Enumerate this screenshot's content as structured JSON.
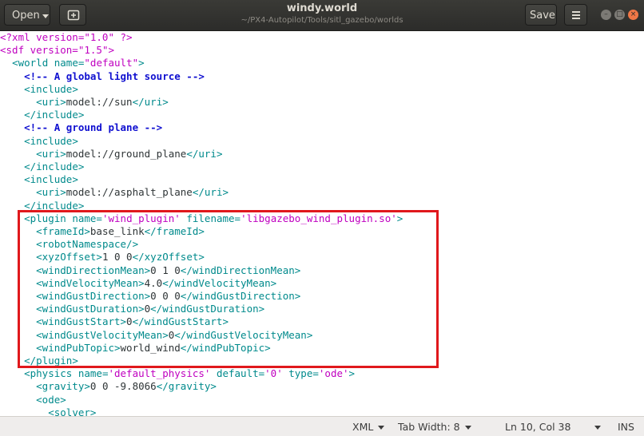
{
  "header": {
    "open_label": "Open",
    "title": "windy.world",
    "subtitle": "~/PX4-Autopilot/Tools/sitl_gazebo/worlds",
    "save_label": "Save"
  },
  "editor": {
    "lines": [
      {
        "indent": "",
        "segments": [
          {
            "t": "<?xml version=\"1.0\" ?>",
            "c": "pi"
          }
        ]
      },
      {
        "indent": "",
        "segments": [
          {
            "t": "<sdf version=",
            "c": "pi"
          },
          {
            "t": "\"1.5\"",
            "c": "pi"
          },
          {
            "t": ">",
            "c": "pi"
          }
        ]
      },
      {
        "indent": "  ",
        "segments": [
          {
            "t": "<world ",
            "c": "tag"
          },
          {
            "t": "name=",
            "c": "attr"
          },
          {
            "t": "\"default\"",
            "c": "val"
          },
          {
            "t": ">",
            "c": "tag"
          }
        ]
      },
      {
        "indent": "    ",
        "segments": [
          {
            "t": "<!-- A global light source -->",
            "c": "comment"
          }
        ]
      },
      {
        "indent": "    ",
        "segments": [
          {
            "t": "<include>",
            "c": "tag"
          }
        ]
      },
      {
        "indent": "      ",
        "segments": [
          {
            "t": "<uri>",
            "c": "tag"
          },
          {
            "t": "model://sun",
            "c": "text"
          },
          {
            "t": "</uri>",
            "c": "tag"
          }
        ]
      },
      {
        "indent": "    ",
        "segments": [
          {
            "t": "</include>",
            "c": "tag"
          }
        ]
      },
      {
        "indent": "    ",
        "segments": [
          {
            "t": "<!-- A ground plane -->",
            "c": "comment"
          }
        ]
      },
      {
        "indent": "    ",
        "segments": [
          {
            "t": "<include>",
            "c": "tag"
          }
        ]
      },
      {
        "indent": "      ",
        "segments": [
          {
            "t": "<uri>",
            "c": "tag"
          },
          {
            "t": "model://ground_plane",
            "c": "text"
          },
          {
            "t": "</uri>",
            "c": "tag"
          }
        ]
      },
      {
        "indent": "    ",
        "segments": [
          {
            "t": "</include>",
            "c": "tag"
          }
        ]
      },
      {
        "indent": "    ",
        "segments": [
          {
            "t": "<include>",
            "c": "tag"
          }
        ]
      },
      {
        "indent": "      ",
        "segments": [
          {
            "t": "<uri>",
            "c": "tag"
          },
          {
            "t": "model://asphalt_plane",
            "c": "text"
          },
          {
            "t": "</uri>",
            "c": "tag"
          }
        ]
      },
      {
        "indent": "    ",
        "segments": [
          {
            "t": "</include>",
            "c": "tag"
          }
        ]
      },
      {
        "indent": "    ",
        "segments": [
          {
            "t": "<plugin ",
            "c": "tag"
          },
          {
            "t": "name=",
            "c": "attr"
          },
          {
            "t": "'wind_plugin'",
            "c": "val"
          },
          {
            "t": " filename=",
            "c": "attr"
          },
          {
            "t": "'libgazebo_wind_plugin.so'",
            "c": "val"
          },
          {
            "t": ">",
            "c": "tag"
          }
        ]
      },
      {
        "indent": "      ",
        "segments": [
          {
            "t": "<frameId>",
            "c": "tag"
          },
          {
            "t": "base_link",
            "c": "text"
          },
          {
            "t": "</frameId>",
            "c": "tag"
          }
        ]
      },
      {
        "indent": "      ",
        "segments": [
          {
            "t": "<robotNamespace/>",
            "c": "tag"
          }
        ]
      },
      {
        "indent": "      ",
        "segments": [
          {
            "t": "<xyzOffset>",
            "c": "tag"
          },
          {
            "t": "1 0 0",
            "c": "text"
          },
          {
            "t": "</xyzOffset>",
            "c": "tag"
          }
        ]
      },
      {
        "indent": "      ",
        "segments": [
          {
            "t": "<windDirectionMean>",
            "c": "tag"
          },
          {
            "t": "0 1 0",
            "c": "text"
          },
          {
            "t": "</windDirectionMean>",
            "c": "tag"
          }
        ]
      },
      {
        "indent": "      ",
        "segments": [
          {
            "t": "<windVelocityMean>",
            "c": "tag"
          },
          {
            "t": "4.0",
            "c": "text"
          },
          {
            "t": "</windVelocityMean>",
            "c": "tag"
          }
        ]
      },
      {
        "indent": "      ",
        "segments": [
          {
            "t": "<windGustDirection>",
            "c": "tag"
          },
          {
            "t": "0 0 0",
            "c": "text"
          },
          {
            "t": "</windGustDirection>",
            "c": "tag"
          }
        ]
      },
      {
        "indent": "      ",
        "segments": [
          {
            "t": "<windGustDuration>",
            "c": "tag"
          },
          {
            "t": "0",
            "c": "text"
          },
          {
            "t": "</windGustDuration>",
            "c": "tag"
          }
        ]
      },
      {
        "indent": "      ",
        "segments": [
          {
            "t": "<windGustStart>",
            "c": "tag"
          },
          {
            "t": "0",
            "c": "text"
          },
          {
            "t": "</windGustStart>",
            "c": "tag"
          }
        ]
      },
      {
        "indent": "      ",
        "segments": [
          {
            "t": "<windGustVelocityMean>",
            "c": "tag"
          },
          {
            "t": "0",
            "c": "text"
          },
          {
            "t": "</windGustVelocityMean>",
            "c": "tag"
          }
        ]
      },
      {
        "indent": "      ",
        "segments": [
          {
            "t": "<windPubTopic>",
            "c": "tag"
          },
          {
            "t": "world_wind",
            "c": "text"
          },
          {
            "t": "</windPubTopic>",
            "c": "tag"
          }
        ]
      },
      {
        "indent": "    ",
        "segments": [
          {
            "t": "</plugin>",
            "c": "tag"
          }
        ]
      },
      {
        "indent": "    ",
        "segments": [
          {
            "t": "<physics ",
            "c": "tag"
          },
          {
            "t": "name=",
            "c": "attr"
          },
          {
            "t": "'default_physics'",
            "c": "val"
          },
          {
            "t": " default=",
            "c": "attr"
          },
          {
            "t": "'0'",
            "c": "val"
          },
          {
            "t": " type=",
            "c": "attr"
          },
          {
            "t": "'ode'",
            "c": "val"
          },
          {
            "t": ">",
            "c": "tag"
          }
        ]
      },
      {
        "indent": "      ",
        "segments": [
          {
            "t": "<gravity>",
            "c": "tag"
          },
          {
            "t": "0 0 -9.8066",
            "c": "text"
          },
          {
            "t": "</gravity>",
            "c": "tag"
          }
        ]
      },
      {
        "indent": "      ",
        "segments": [
          {
            "t": "<ode>",
            "c": "tag"
          }
        ]
      },
      {
        "indent": "        ",
        "segments": [
          {
            "t": "<solver>",
            "c": "tag"
          }
        ]
      }
    ]
  },
  "statusbar": {
    "language": "XML",
    "tab_width": "Tab Width: 8",
    "position": "Ln 10, Col 38",
    "mode": "INS"
  },
  "colors": {
    "highlight_box": "#e0181c",
    "tag": "#008a8c",
    "value": "#c000c0",
    "comment": "#1010d0"
  }
}
